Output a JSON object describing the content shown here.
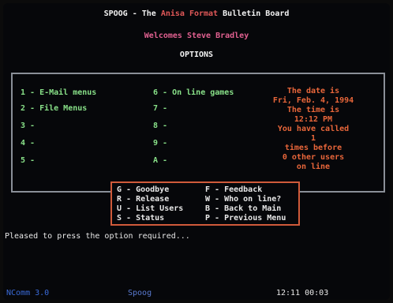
{
  "header": {
    "title_part1": "SPOOG - The ",
    "title_part2": "Anisa Format ",
    "title_part3": "Bulletin Board",
    "welcome": "Welcomes Steve Bradley",
    "options_heading": "OPTIONS"
  },
  "menu": {
    "left_options": [
      "1 - E-Mail menus",
      "2 - File Menus",
      "3 -",
      "4 -",
      "5 -"
    ],
    "right_options": [
      "6 - On line games",
      "7 -",
      "8 -",
      "9 -",
      "A -"
    ]
  },
  "info": {
    "line1": "The date is",
    "line2": "Fri, Feb. 4, 1994",
    "line3": "The time is",
    "line4": "12:12 PM",
    "line5": "You have called",
    "line6": "1",
    "line7": "times before",
    "line8": "0   other users",
    "line9": "on line"
  },
  "commands": {
    "left": [
      "G - Goodbye",
      "R - Release",
      "U - List Users",
      "S - Status"
    ],
    "right": [
      "F - Feedback",
      "W - Who on line?",
      "B - Back to Main",
      "P - Previous Menu"
    ]
  },
  "prompt": "Pleased to press the option required...",
  "status_bar": {
    "app": "NComm 3.0",
    "user": "Spoog",
    "time": "12:11 00:03"
  },
  "colors": {
    "background": "#06070a",
    "frame": "#8a8f98",
    "command_frame": "#d05a3a",
    "option_text": "#88e088",
    "info_text": "#e8663a",
    "welcome_text": "#e06090"
  }
}
